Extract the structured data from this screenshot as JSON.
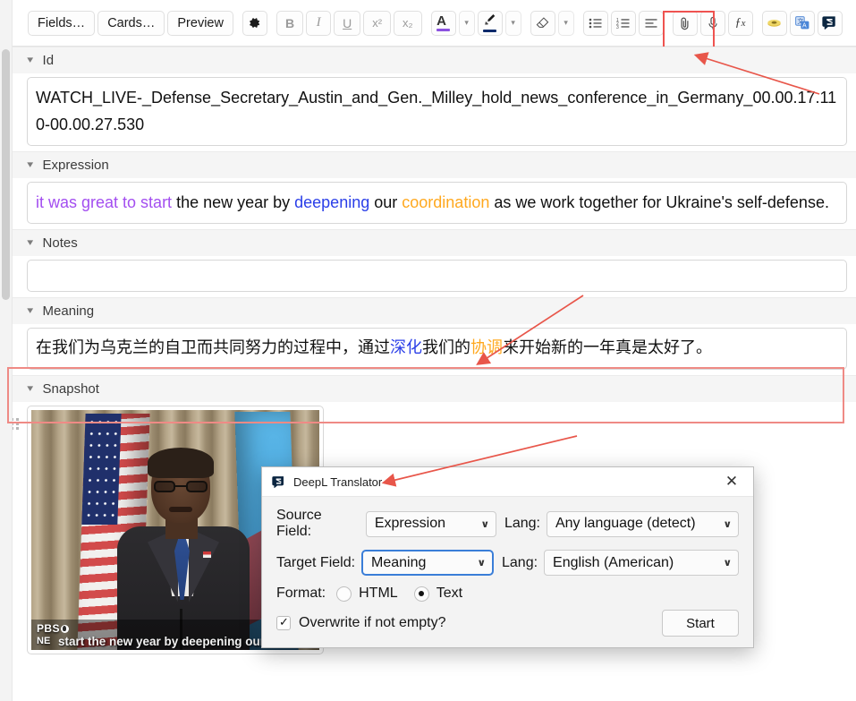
{
  "toolbar": {
    "buttons": [
      {
        "name": "fields-button",
        "label": "Fields…",
        "kind": "text"
      },
      {
        "name": "cards-button",
        "label": "Cards…",
        "kind": "text"
      },
      {
        "name": "preview-button",
        "label": "Preview",
        "kind": "text"
      },
      {
        "name": "settings-gear-button",
        "label": "⚙",
        "kind": "icon"
      },
      {
        "name": "bold-button",
        "label": "B",
        "kind": "fmt"
      },
      {
        "name": "italic-button",
        "label": "I",
        "kind": "fmt"
      },
      {
        "name": "underline-button",
        "label": "U",
        "kind": "fmt"
      },
      {
        "name": "superscript-button",
        "label": "x²",
        "kind": "fmt"
      },
      {
        "name": "subscript-button",
        "label": "x₂",
        "kind": "fmt"
      },
      {
        "name": "text-color-button",
        "label": "A",
        "kind": "color",
        "color": "#8b52e0"
      },
      {
        "name": "text-color-dropdown",
        "label": "⌄",
        "kind": "chev"
      },
      {
        "name": "highlight-color-button",
        "label": "✎",
        "kind": "color",
        "color": "#0b2a6b"
      },
      {
        "name": "highlight-color-dropdown",
        "label": "⌄",
        "kind": "chev"
      },
      {
        "name": "remove-formatting-button",
        "label": "◇",
        "kind": "icon"
      },
      {
        "name": "remove-formatting-dropdown",
        "label": "⌄",
        "kind": "chev"
      },
      {
        "name": "bulleted-list-button",
        "label": "≡",
        "kind": "icon"
      },
      {
        "name": "numbered-list-button",
        "label": "≡",
        "kind": "icon"
      },
      {
        "name": "align-button",
        "label": "≡",
        "kind": "icon"
      },
      {
        "name": "attach-media-button",
        "label": "📎",
        "kind": "icon"
      },
      {
        "name": "record-audio-button",
        "label": "🎙",
        "kind": "icon"
      },
      {
        "name": "mathjax-button",
        "label": "ƒx",
        "kind": "icon"
      },
      {
        "name": "image-occlusion-button",
        "label": "🟡",
        "kind": "icon"
      },
      {
        "name": "google-translate-button",
        "label": "ɡ",
        "kind": "icon"
      },
      {
        "name": "deepl-translator-button",
        "label": "⚘",
        "kind": "icon"
      }
    ]
  },
  "fields": [
    {
      "name": "id",
      "label": "Id",
      "value": "WATCH_LIVE-_Defense_Secretary_Austin_and_Gen._Milley_hold_news_conference_in_Germany_00.00.17.110-00.00.27.530"
    },
    {
      "name": "expression",
      "label": "Expression",
      "segments": [
        {
          "text": "it was great to start",
          "color": "purple"
        },
        {
          "text": " the new year by ",
          "color": "plain"
        },
        {
          "text": "deepening",
          "color": "blue"
        },
        {
          "text": " our ",
          "color": "plain"
        },
        {
          "text": "coordination",
          "color": "orange"
        },
        {
          "text": " as we work together for Ukraine's self-defense.",
          "color": "plain"
        }
      ]
    },
    {
      "name": "notes",
      "label": "Notes",
      "value": ""
    },
    {
      "name": "meaning",
      "label": "Meaning",
      "segments": [
        {
          "text": "在我们为乌克兰的自卫而共同努力的过程中，通过",
          "color": "plain"
        },
        {
          "text": "深化",
          "color": "blue"
        },
        {
          "text": "我们的",
          "color": "plain"
        },
        {
          "text": "协调",
          "color": "orange"
        },
        {
          "text": "来开始新的一年真是太好了。",
          "color": "plain"
        }
      ]
    },
    {
      "name": "snapshot",
      "label": "Snapshot"
    }
  ],
  "snapshot": {
    "watermark_main": "PBS",
    "watermark_sub": "NEWSHOUR",
    "caption": "start the new year by deepening our coordination"
  },
  "dialog": {
    "title": "DeepL Translator",
    "close_label": "✕",
    "source_field_label": "Source Field:",
    "source_field_value": "Expression",
    "source_lang_label": "Lang:",
    "source_lang_value": "Any language (detect)",
    "target_field_label": "Target Field:",
    "target_field_value": "Meaning",
    "target_lang_label": "Lang:",
    "target_lang_value": "English (American)",
    "format_label": "Format:",
    "format_html_label": "HTML",
    "format_text_label": "Text",
    "format_selected": "Text",
    "overwrite_label": "Overwrite if not empty?",
    "overwrite_checked": true,
    "start_label": "Start",
    "chevron": "∨"
  },
  "colors": {
    "accent_purple": "#a34ef0",
    "accent_blue": "#2b3fe8",
    "accent_orange": "#ffa81e",
    "annotation_red": "#ef5350",
    "focus_blue": "#3a7ed8"
  }
}
